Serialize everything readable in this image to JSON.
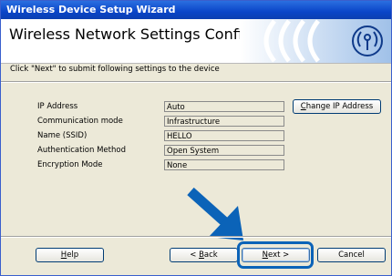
{
  "window": {
    "title": "Wireless Device Setup Wizard"
  },
  "header": {
    "title": "Wireless Network Settings Confirmation"
  },
  "subtitle": "Click \"Next\" to submit following settings to the device",
  "settings": [
    {
      "label": "IP Address",
      "value": "Auto"
    },
    {
      "label": "Communication mode",
      "value": "Infrastructure"
    },
    {
      "label": "Name (SSID)",
      "value": "HELLO"
    },
    {
      "label": "Authentication Method",
      "value": "Open System"
    },
    {
      "label": "Encryption Mode",
      "value": "None"
    }
  ],
  "buttons": {
    "change_ip": {
      "mnemonic": "C",
      "rest": "hange IP Address"
    },
    "help": {
      "mnemonic": "H",
      "rest": "elp"
    },
    "back": {
      "prefix": "< ",
      "mnemonic": "B",
      "rest": "ack"
    },
    "next": {
      "mnemonic": "N",
      "rest": "ext >"
    },
    "cancel": "Cancel"
  },
  "colors": {
    "accent": "#0b63b8",
    "titlebar": "#0a45c8"
  },
  "icons": {
    "header": "wireless-waves-icon",
    "pointer": "arrow-pointer-icon"
  }
}
